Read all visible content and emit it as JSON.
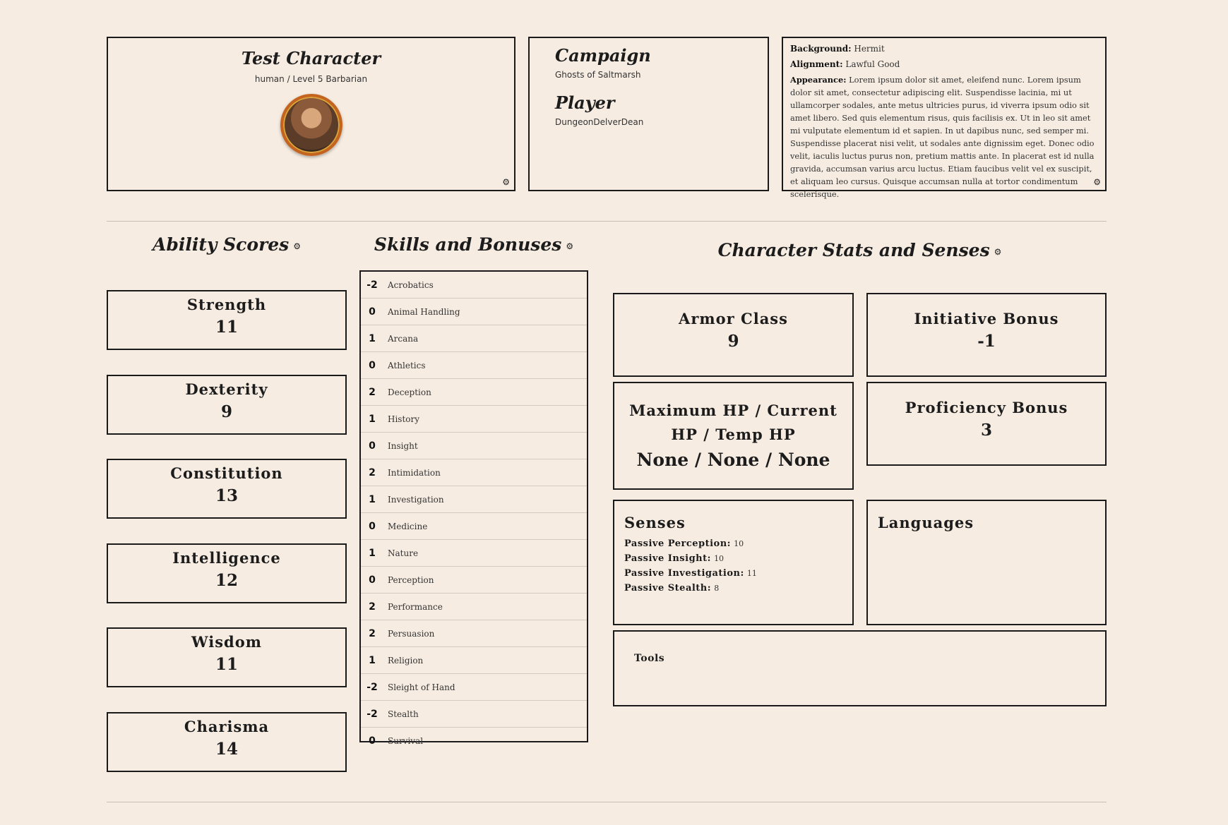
{
  "header": {
    "character_name": "Test Character",
    "character_subtitle": "human / Level 5 Barbarian",
    "campaign_label": "Campaign",
    "campaign_value": "Ghosts of Saltmarsh",
    "player_label": "Player",
    "player_value": "DungeonDelverDean",
    "background_label": "Background:",
    "background_value": "Hermit",
    "alignment_label": "Alignment:",
    "alignment_value": "Lawful Good",
    "appearance_label": "Appearance:",
    "appearance_value": "Lorem ipsum dolor sit amet, eleifend nunc. Lorem ipsum dolor sit amet, consectetur adipiscing elit. Suspendisse lacinia, mi ut ullamcorper sodales, ante metus ultricies purus, id viverra ipsum odio sit amet libero. Sed quis elementum risus, quis facilisis ex. Ut in leo sit amet mi vulputate elementum id et sapien. In ut dapibus nunc, sed semper mi. Suspendisse placerat nisi velit, ut sodales ante dignissim eget. Donec odio velit, iaculis luctus purus non, pretium mattis ante. In placerat est id nulla gravida, accumsan varius arcu luctus. Etiam faucibus velit vel ex suscipit, et aliquam leo cursus. Quisque accumsan nulla at tortor condimentum scelerisque."
  },
  "icons": {
    "settings": "gear-icon",
    "settings_glyph": "⚙"
  },
  "sections": {
    "ability_scores": "Ability Scores",
    "skills": "Skills and Bonuses",
    "stats": "Character Stats and Senses"
  },
  "abilities": [
    {
      "name": "Strength",
      "value": "11"
    },
    {
      "name": "Dexterity",
      "value": "9"
    },
    {
      "name": "Constitution",
      "value": "13"
    },
    {
      "name": "Intelligence",
      "value": "12"
    },
    {
      "name": "Wisdom",
      "value": "11"
    },
    {
      "name": "Charisma",
      "value": "14"
    }
  ],
  "skills": [
    {
      "mod": "-2",
      "name": "Acrobatics"
    },
    {
      "mod": "0",
      "name": "Animal Handling"
    },
    {
      "mod": "1",
      "name": "Arcana"
    },
    {
      "mod": "0",
      "name": "Athletics"
    },
    {
      "mod": "2",
      "name": "Deception"
    },
    {
      "mod": "1",
      "name": "History"
    },
    {
      "mod": "0",
      "name": "Insight"
    },
    {
      "mod": "2",
      "name": "Intimidation"
    },
    {
      "mod": "1",
      "name": "Investigation"
    },
    {
      "mod": "0",
      "name": "Medicine"
    },
    {
      "mod": "1",
      "name": "Nature"
    },
    {
      "mod": "0",
      "name": "Perception"
    },
    {
      "mod": "2",
      "name": "Performance"
    },
    {
      "mod": "2",
      "name": "Persuasion"
    },
    {
      "mod": "1",
      "name": "Religion"
    },
    {
      "mod": "-2",
      "name": "Sleight of Hand"
    },
    {
      "mod": "-2",
      "name": "Stealth"
    },
    {
      "mod": "0",
      "name": "Survival"
    }
  ],
  "stats": {
    "armor_class_label": "Armor Class",
    "armor_class_value": "9",
    "initiative_label": "Initiative Bonus",
    "initiative_value": "-1",
    "hp_label": "Maximum HP / Current HP / Temp HP",
    "hp_value": "None / None / None",
    "proficiency_label": "Proficiency Bonus",
    "proficiency_value": "3"
  },
  "senses": {
    "title": "Senses",
    "items": [
      {
        "label": "Passive Perception:",
        "value": "10"
      },
      {
        "label": "Passive Insight:",
        "value": "10"
      },
      {
        "label": "Passive Investigation:",
        "value": "11"
      },
      {
        "label": "Passive Stealth:",
        "value": "8"
      }
    ]
  },
  "languages": {
    "title": "Languages"
  },
  "tools": {
    "title": "Tools"
  }
}
